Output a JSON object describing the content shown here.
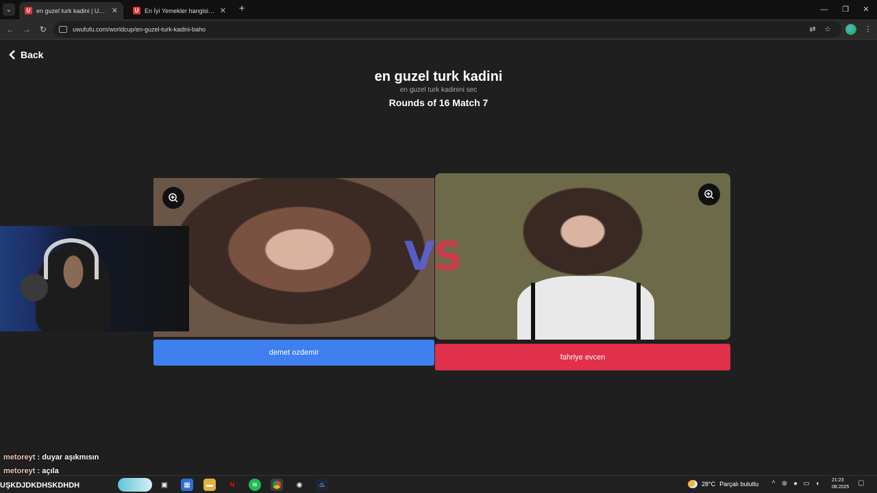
{
  "browser": {
    "tabs": [
      {
        "title": "en guzel turk kadini | UwUFUFU",
        "active": true
      },
      {
        "title": "En İyi Yemekler hangisidir | UwU",
        "active": false
      }
    ],
    "url": "uwufufu.com/worldcup/en-guzel-turk-kadini-baho"
  },
  "page": {
    "back_label": "Back",
    "title": "en guzel turk kadini",
    "subtitle": "en guzel turk kadinini sec",
    "round_info": "Rounds of 16 Match 7",
    "vs_v": "V",
    "vs_s": "S",
    "left_choice": "demet ozdemir",
    "right_choice": "fahriye evcen",
    "colors": {
      "left_button": "#3f7ff0",
      "right_button": "#e0304a"
    }
  },
  "chat": [
    {
      "user": "metoreyt",
      "message": "duyar aşıkmısın"
    },
    {
      "user": "metoreyt",
      "message": "açıla"
    }
  ],
  "taskbar": {
    "label": "UŞKDJDKDHSKDHDH",
    "weather_temp": "28°C",
    "weather_text": "Parçalı bulutlu",
    "time": "21:23",
    "date": "08.2025"
  }
}
